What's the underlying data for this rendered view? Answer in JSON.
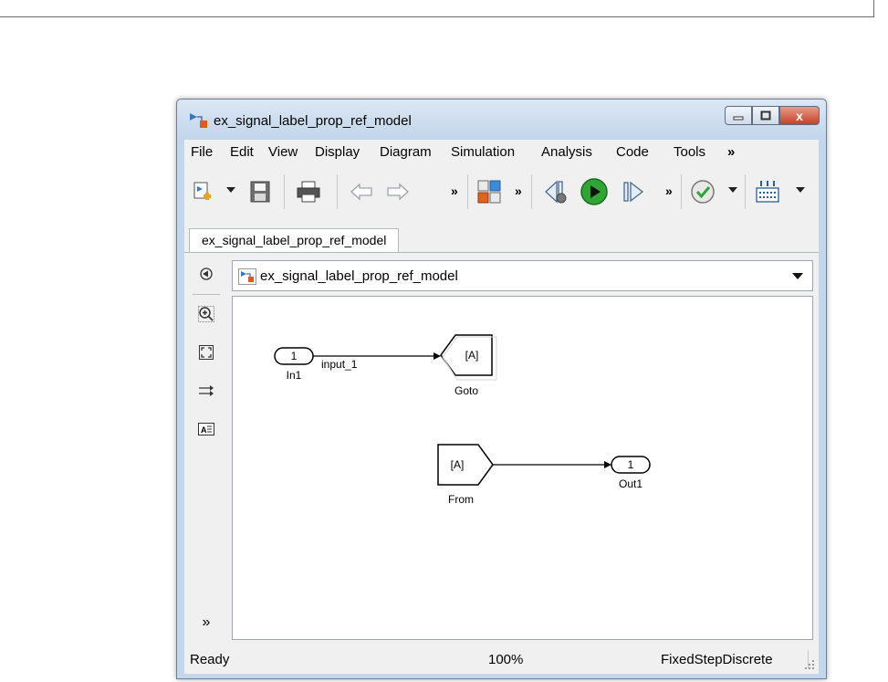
{
  "window": {
    "title": "ex_signal_label_prop_ref_model",
    "close_glyph": "x"
  },
  "menu": [
    "File",
    "Edit",
    "View",
    "Display",
    "Diagram",
    "Simulation",
    "Analysis",
    "Code",
    "Tools",
    "»"
  ],
  "toolbar": {
    "chevron": "»",
    "icons": [
      "new-model-icon",
      "save-icon",
      "print-icon",
      "back-arrow-icon",
      "forward-arrow-icon",
      "library-browser-icon",
      "step-back-icon",
      "run-icon",
      "step-forward-icon",
      "model-advisor-icon",
      "build-icon"
    ]
  },
  "tab": {
    "label": "ex_signal_label_prop_ref_model"
  },
  "address": {
    "text": "ex_signal_label_prop_ref_model"
  },
  "diagram": {
    "in1": {
      "port": "1",
      "name": "In1"
    },
    "signal_label": "input_1",
    "goto": {
      "tag": "[A]",
      "name": "Goto"
    },
    "from": {
      "tag": "[A]",
      "name": "From"
    },
    "out1": {
      "port": "1",
      "name": "Out1"
    }
  },
  "status": {
    "state": "Ready",
    "zoom": "100%",
    "solver": "FixedStepDiscrete"
  },
  "left_panel": {
    "expand": "»"
  },
  "colors": {
    "run_green": "#2fa534",
    "title_bar": "#c2d5ea",
    "close_red": "#c5412a"
  }
}
